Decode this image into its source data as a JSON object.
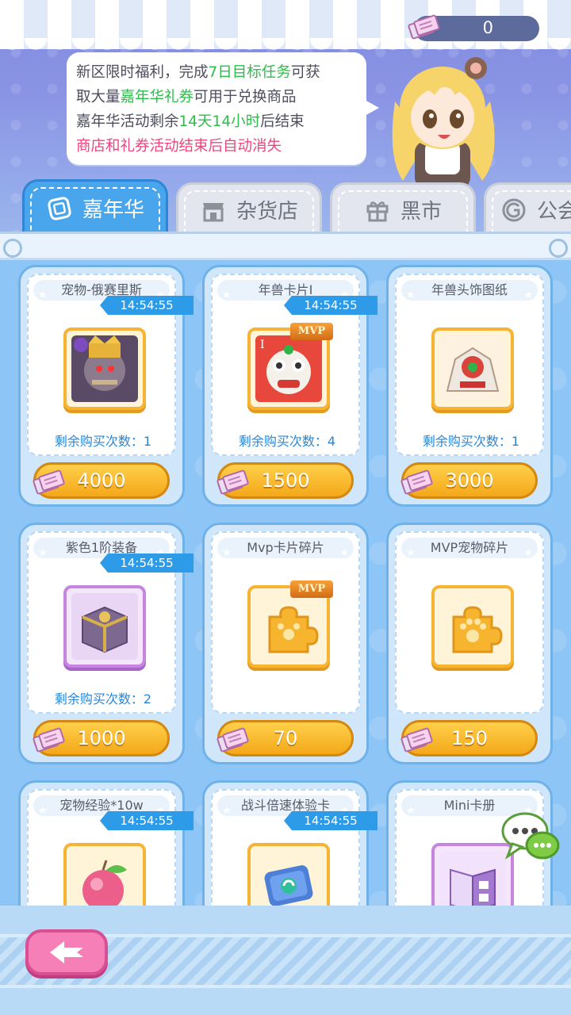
{
  "header": {
    "currency_value": "0",
    "notice": {
      "line1_a": "新区限时福利，完成",
      "line1_b": "7日目标任务",
      "line1_c": "可获",
      "line2_a": "取大量",
      "line2_b": "嘉年华礼券",
      "line2_c": "可用于兑换商品",
      "line3_a": "嘉年华活动剩余",
      "line3_b": "14天14小时",
      "line3_c": "后结束",
      "line4": "商店和礼券活动结束后自动消失"
    }
  },
  "tabs": [
    {
      "label": "嘉年华",
      "icon": "carnival-ticket-icon",
      "active": true
    },
    {
      "label": "杂货店",
      "icon": "store-icon",
      "active": false
    },
    {
      "label": "黑市",
      "icon": "gift-icon",
      "active": false
    },
    {
      "label": "公会",
      "icon": "guild-icon",
      "active": false
    }
  ],
  "items": [
    {
      "title": "宠物-俄赛里斯",
      "timer": "14:54:55",
      "remain": "剩余购买次数：1",
      "price": "4000",
      "icon": "pet-osiris-icon"
    },
    {
      "title": "年兽卡片Ⅰ",
      "timer": "14:54:55",
      "remain": "剩余购买次数：4",
      "price": "1500",
      "icon": "nian-card-icon",
      "badge": "MVP"
    },
    {
      "title": "年兽头饰图纸",
      "timer": "",
      "remain": "剩余购买次数：1",
      "price": "3000",
      "icon": "nian-headwear-icon"
    },
    {
      "title": "紫色1阶装备",
      "timer": "14:54:55",
      "remain": "剩余购买次数：2",
      "price": "1000",
      "icon": "purple-chest-icon"
    },
    {
      "title": "Mvp卡片碎片",
      "timer": "",
      "remain": "",
      "price": "70",
      "icon": "mvp-puzzle-icon",
      "badge": "MVP"
    },
    {
      "title": "MVP宠物碎片",
      "timer": "",
      "remain": "",
      "price": "150",
      "icon": "pet-puzzle-icon"
    },
    {
      "title": "宠物经验*10w",
      "timer": "14:54:55",
      "remain": "",
      "price": "",
      "icon": "peach-icon"
    },
    {
      "title": "战斗倍速体验卡",
      "timer": "14:54:55",
      "remain": "",
      "price": "",
      "icon": "speed-card-icon"
    },
    {
      "title": "Mini卡册",
      "timer": "",
      "remain": "",
      "price": "",
      "icon": "mini-album-icon"
    }
  ],
  "colors": {
    "accent_blue": "#4aa6ec",
    "price_orange": "#f4a81a",
    "highlight_green": "#2bbf4a",
    "highlight_red": "#f0457c",
    "back_pink": "#f57fb6"
  }
}
